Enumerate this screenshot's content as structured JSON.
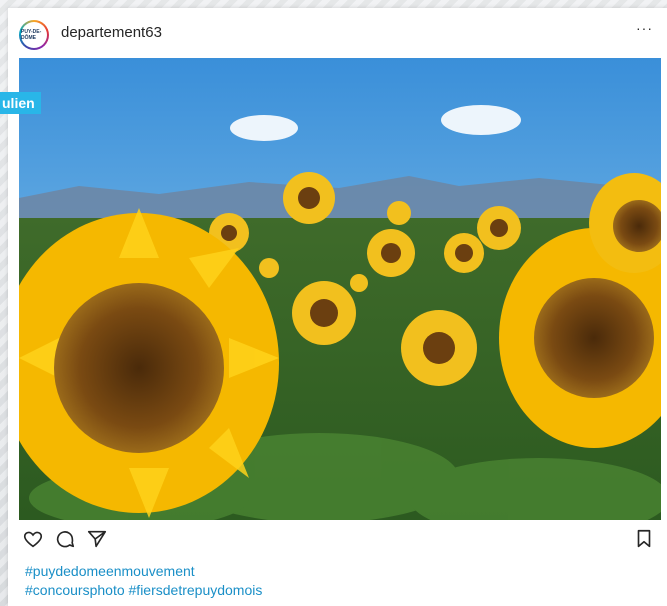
{
  "post": {
    "username": "departement63",
    "avatar_label": "PUY-DE-DÔME",
    "more_label": "···",
    "overlay_tag": "ulien",
    "caption": {
      "line1": "#puydedomeenmouvement",
      "line2": "#concoursphoto #fiersdetrepuydomois"
    }
  },
  "icons": {
    "like": "heart-icon",
    "comment": "comment-icon",
    "share": "send-icon",
    "save": "bookmark-icon"
  },
  "colors": {
    "link": "#1a8fc7",
    "overlay": "#29b6e8",
    "text": "#262626"
  }
}
